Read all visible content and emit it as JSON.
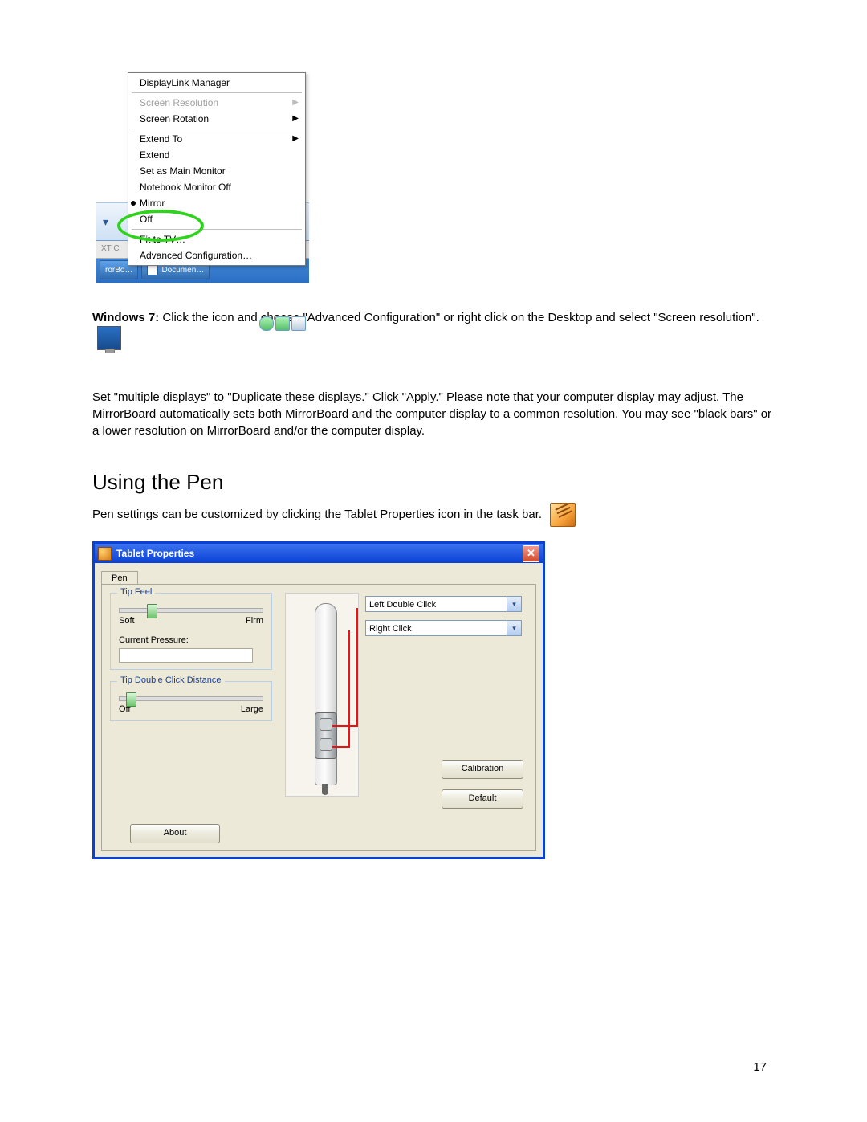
{
  "page_number": "17",
  "fig_menu": {
    "items": [
      {
        "label": "DisplayLink Manager",
        "disabled": false,
        "submenu": false
      },
      {
        "divider": true
      },
      {
        "label": "Screen Resolution",
        "disabled": true,
        "submenu": true
      },
      {
        "label": "Screen Rotation",
        "disabled": false,
        "submenu": true
      },
      {
        "divider": true
      },
      {
        "label": "Extend To",
        "disabled": false,
        "submenu": true
      },
      {
        "label": "Extend",
        "disabled": false,
        "submenu": false
      },
      {
        "label": "Set as Main Monitor",
        "disabled": false,
        "submenu": false
      },
      {
        "label": "Notebook Monitor Off",
        "disabled": false,
        "submenu": false
      },
      {
        "label": "Mirror",
        "disabled": false,
        "submenu": false,
        "bullet": true
      },
      {
        "label": "Off",
        "disabled": false,
        "submenu": false
      },
      {
        "divider": true
      },
      {
        "label": "Fit to TV…",
        "disabled": false,
        "submenu": false
      },
      {
        "label": "Advanced Configuration…",
        "disabled": false,
        "submenu": false
      }
    ],
    "taskbar": {
      "btn1": "rorBo…",
      "btn2": "Documen…",
      "tabrow": "XT  C"
    }
  },
  "text": {
    "win7_bold": "Windows 7:",
    "win7_rest": " Click the icon and choose \"Advanced Configuration\" or right click on the Desktop and select \"Screen resolution\".",
    "duplicate_para": "Set \"multiple displays\" to \"Duplicate these displays.\"  Click \"Apply.\"  Please note that your computer display may adjust.  The MirrorBoard automatically sets both MirrorBoard and the computer display to a common resolution.  You may see \"black bars\" or a lower resolution on MirrorBoard and/or the computer display.",
    "section_heading": "Using the Pen",
    "pen_para": "Pen settings can be customized by clicking the Tablet Properties icon in the task bar."
  },
  "tablet_dialog": {
    "title": "Tablet Properties",
    "tab": "Pen",
    "tip_feel_legend": "Tip Feel",
    "soft": "Soft",
    "firm": "Firm",
    "current_pressure": "Current Pressure:",
    "tip_dbl_legend": "Tip Double Click Distance",
    "off": "Off",
    "large": "Large",
    "dd_top": "Left Double Click",
    "dd_bottom": "Right Click",
    "btn_calibration": "Calibration",
    "btn_default": "Default",
    "btn_about": "About"
  }
}
